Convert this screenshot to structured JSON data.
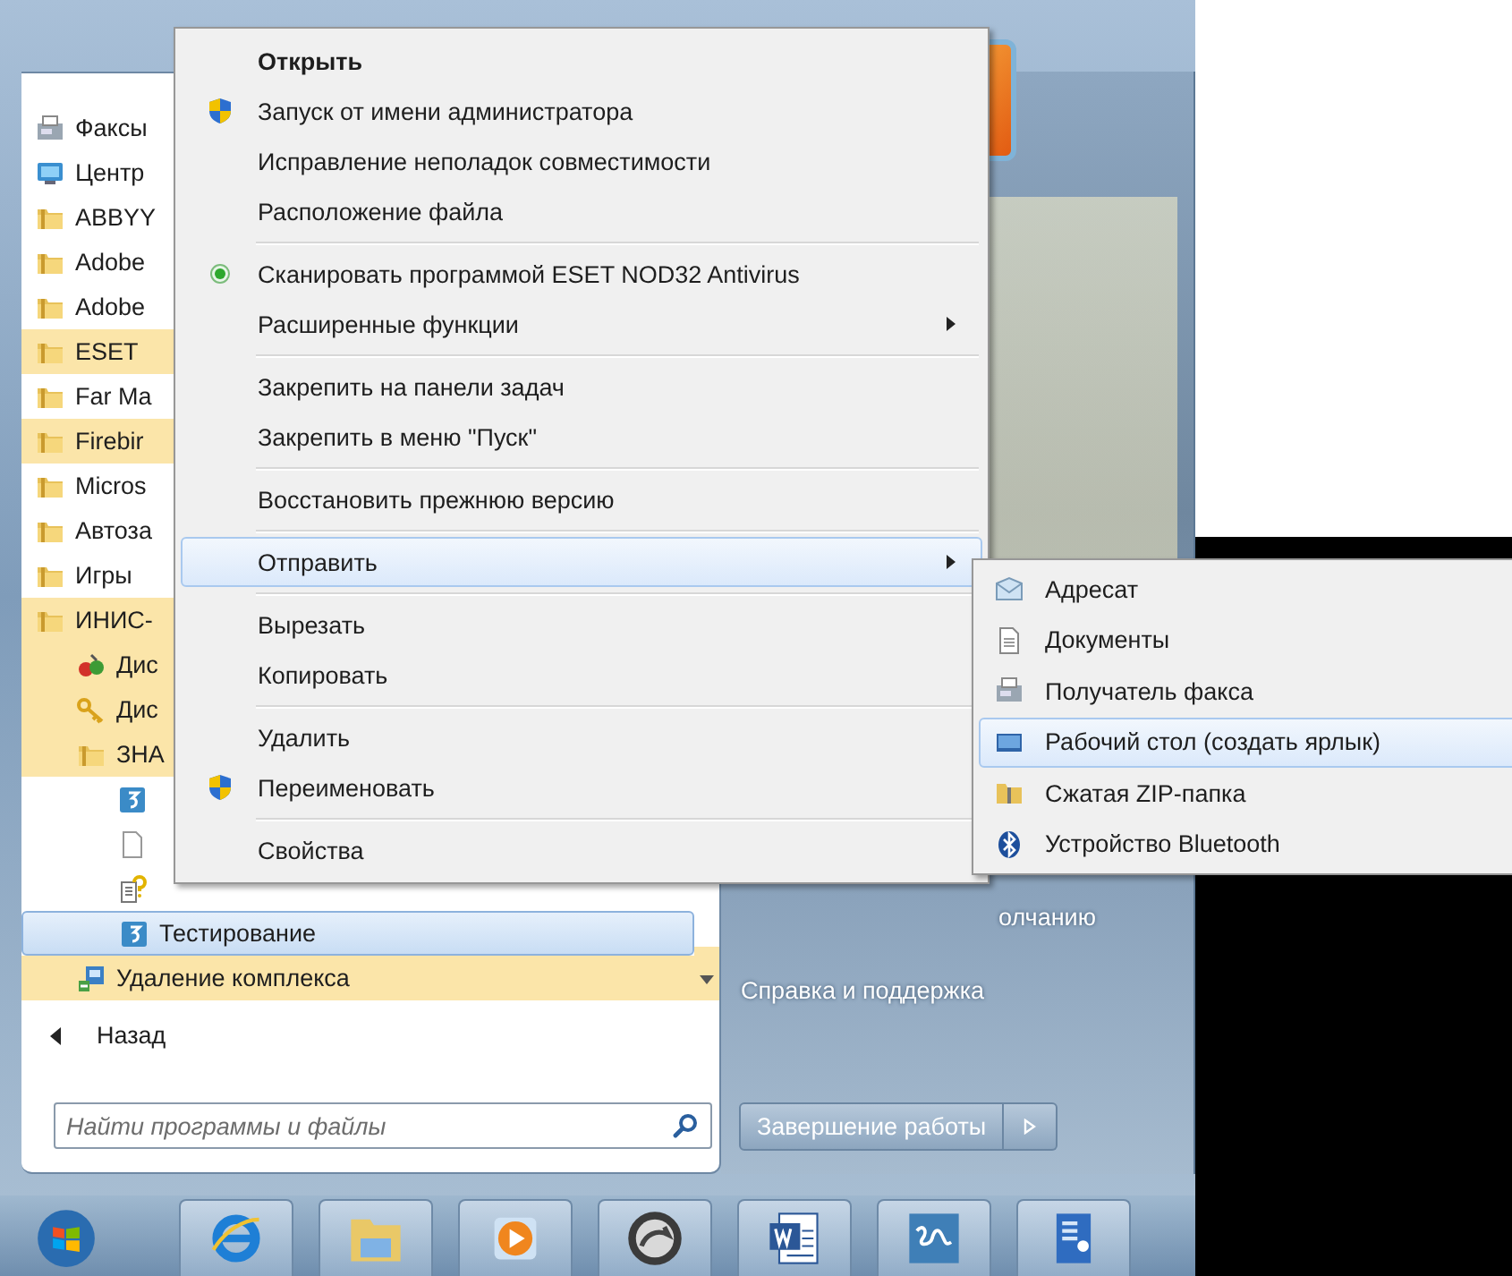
{
  "start_menu": {
    "programs": [
      {
        "label": "Факсы",
        "kind": "fax",
        "new": false,
        "selected": false
      },
      {
        "label": "Центр",
        "kind": "center",
        "new": false,
        "selected": false
      },
      {
        "label": "ABBYY",
        "kind": "folder",
        "new": false,
        "selected": false
      },
      {
        "label": "Adobe",
        "kind": "folder",
        "new": false,
        "selected": false
      },
      {
        "label": "Adobe",
        "kind": "folder",
        "new": false,
        "selected": false
      },
      {
        "label": "ESET",
        "kind": "folder",
        "new": true,
        "selected": false
      },
      {
        "label": "Far Ma",
        "kind": "folder",
        "new": false,
        "selected": false
      },
      {
        "label": "Firebir",
        "kind": "folder",
        "new": true,
        "selected": false
      },
      {
        "label": "Micros",
        "kind": "folder",
        "new": false,
        "selected": false
      },
      {
        "label": "Автоза",
        "kind": "folder",
        "new": false,
        "selected": false
      },
      {
        "label": "Игры",
        "kind": "folder",
        "new": false,
        "selected": false
      },
      {
        "label": "ИНИС-",
        "kind": "folder",
        "new": true,
        "selected": false,
        "children": [
          {
            "label": "Дис",
            "kind": "apps",
            "new": true,
            "selected": false
          },
          {
            "label": "Дис",
            "kind": "key",
            "new": true,
            "selected": false
          },
          {
            "label": "ЗНА",
            "kind": "folder",
            "new": true,
            "selected": false,
            "children": [
              {
                "kind": "app",
                "new": false,
                "selected": false
              },
              {
                "kind": "document",
                "new": false,
                "selected": false
              },
              {
                "kind": "help",
                "new": false,
                "selected": false
              },
              {
                "label": "Тестирование",
                "kind": "app",
                "new": false,
                "selected": true
              }
            ]
          },
          {
            "label": "Удаление комплекса",
            "kind": "uninstall",
            "new": true,
            "selected": false
          }
        ]
      }
    ],
    "back": {
      "label": "Назад"
    },
    "search": {
      "placeholder": "Найти программы и файлы"
    },
    "right_panel": {
      "items": [
        {
          "label": "олчанию"
        },
        {
          "label": "Справка и поддержка"
        }
      ]
    },
    "shutdown": {
      "label": "Завершение работы"
    }
  },
  "context_menu": {
    "items": [
      {
        "kind": "default",
        "label": "Открыть",
        "selected": false,
        "submenu": false
      },
      {
        "kind": "elevated",
        "label": "Запуск от имени администратора",
        "selected": false,
        "submenu": false
      },
      {
        "kind": "plain",
        "label": "Исправление неполадок совместимости",
        "selected": false,
        "submenu": false
      },
      {
        "kind": "plain",
        "label": "Расположение файла",
        "selected": false,
        "submenu": false
      },
      {
        "kind": "separator"
      },
      {
        "kind": "scan",
        "label": "Сканировать программой ESET NOD32 Antivirus",
        "selected": false,
        "submenu": false
      },
      {
        "kind": "plain",
        "label": "Расширенные функции",
        "selected": false,
        "submenu": true
      },
      {
        "kind": "separator"
      },
      {
        "kind": "plain",
        "label": "Закрепить на панели задач",
        "selected": false,
        "submenu": false
      },
      {
        "kind": "plain",
        "label": "Закрепить в меню \"Пуск\"",
        "selected": false,
        "submenu": false
      },
      {
        "kind": "separator"
      },
      {
        "kind": "plain",
        "label": "Восстановить прежнюю версию",
        "selected": false,
        "submenu": false
      },
      {
        "kind": "separator"
      },
      {
        "kind": "plain",
        "label": "Отправить",
        "selected": true,
        "submenu": true
      },
      {
        "kind": "separator"
      },
      {
        "kind": "plain",
        "label": "Вырезать",
        "selected": false,
        "submenu": false
      },
      {
        "kind": "plain",
        "label": "Копировать",
        "selected": false,
        "submenu": false
      },
      {
        "kind": "separator"
      },
      {
        "kind": "plain",
        "label": "Удалить",
        "selected": false,
        "submenu": false
      },
      {
        "kind": "elevated",
        "label": "Переименовать",
        "selected": false,
        "submenu": false
      },
      {
        "kind": "separator"
      },
      {
        "kind": "plain",
        "label": "Свойства",
        "selected": false,
        "submenu": false
      }
    ]
  },
  "send_to_menu": {
    "items": [
      {
        "kind": "mail",
        "label": "Адресат",
        "selected": false
      },
      {
        "kind": "documents",
        "label": "Документы",
        "selected": false
      },
      {
        "kind": "fax",
        "label": "Получатель факса",
        "selected": false
      },
      {
        "kind": "desktop",
        "label": "Рабочий стол (создать ярлык)",
        "selected": true
      },
      {
        "kind": "zip",
        "label": "Сжатая ZIP-папка",
        "selected": false
      },
      {
        "kind": "bluetooth",
        "label": "Устройство Bluetooth",
        "selected": false
      }
    ]
  },
  "taskbar": {
    "buttons": [
      {
        "kind": "start"
      },
      {
        "kind": "browser"
      },
      {
        "kind": "folder"
      },
      {
        "kind": "player"
      },
      {
        "kind": "circle"
      },
      {
        "kind": "writer"
      },
      {
        "kind": "logo"
      },
      {
        "kind": "document"
      }
    ]
  }
}
